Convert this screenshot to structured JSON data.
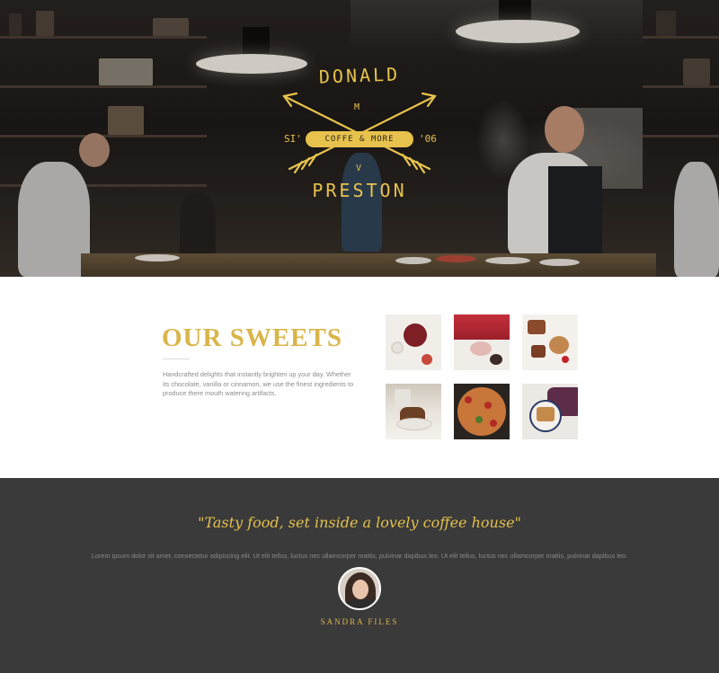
{
  "hero": {
    "logo": {
      "name_top": "DONALD",
      "name_bottom": "PRESTON",
      "initial_top": "M",
      "initial_bottom": "V",
      "left_mark": "SI'",
      "right_mark": "'06",
      "tagline": "COFFE & MORE",
      "accent_color": "#e7c24d"
    }
  },
  "sweets": {
    "title": "OUR SWEETS",
    "description": "Handcrafted delights that instantly brighten up your day. Whether its chocolate, vanilla or cinnamon, we use the finest ingredients to produce there mouth watering artifacts.",
    "title_color": "#d9b54a",
    "gallery": [
      {
        "name": "sweet-photo-1"
      },
      {
        "name": "sweet-photo-2"
      },
      {
        "name": "sweet-photo-3"
      },
      {
        "name": "sweet-photo-4"
      },
      {
        "name": "sweet-photo-5"
      },
      {
        "name": "sweet-photo-6"
      }
    ]
  },
  "testimonial": {
    "quote": "\"Tasty food, set inside a lovely coffee house\"",
    "body": "Lorem ipsum dolor sit amet, consectetur adipiscing elit. Ut elit tellus, luctus nec ullamcorper mattis, pulvinar dapibus leo. Ut elit tellus, luctus nec ullamcorper mattis, pulvinar dapibus leo.",
    "author": "SANDRA FILES",
    "background": "#3a3a3a",
    "quote_color": "#e3c04d"
  }
}
